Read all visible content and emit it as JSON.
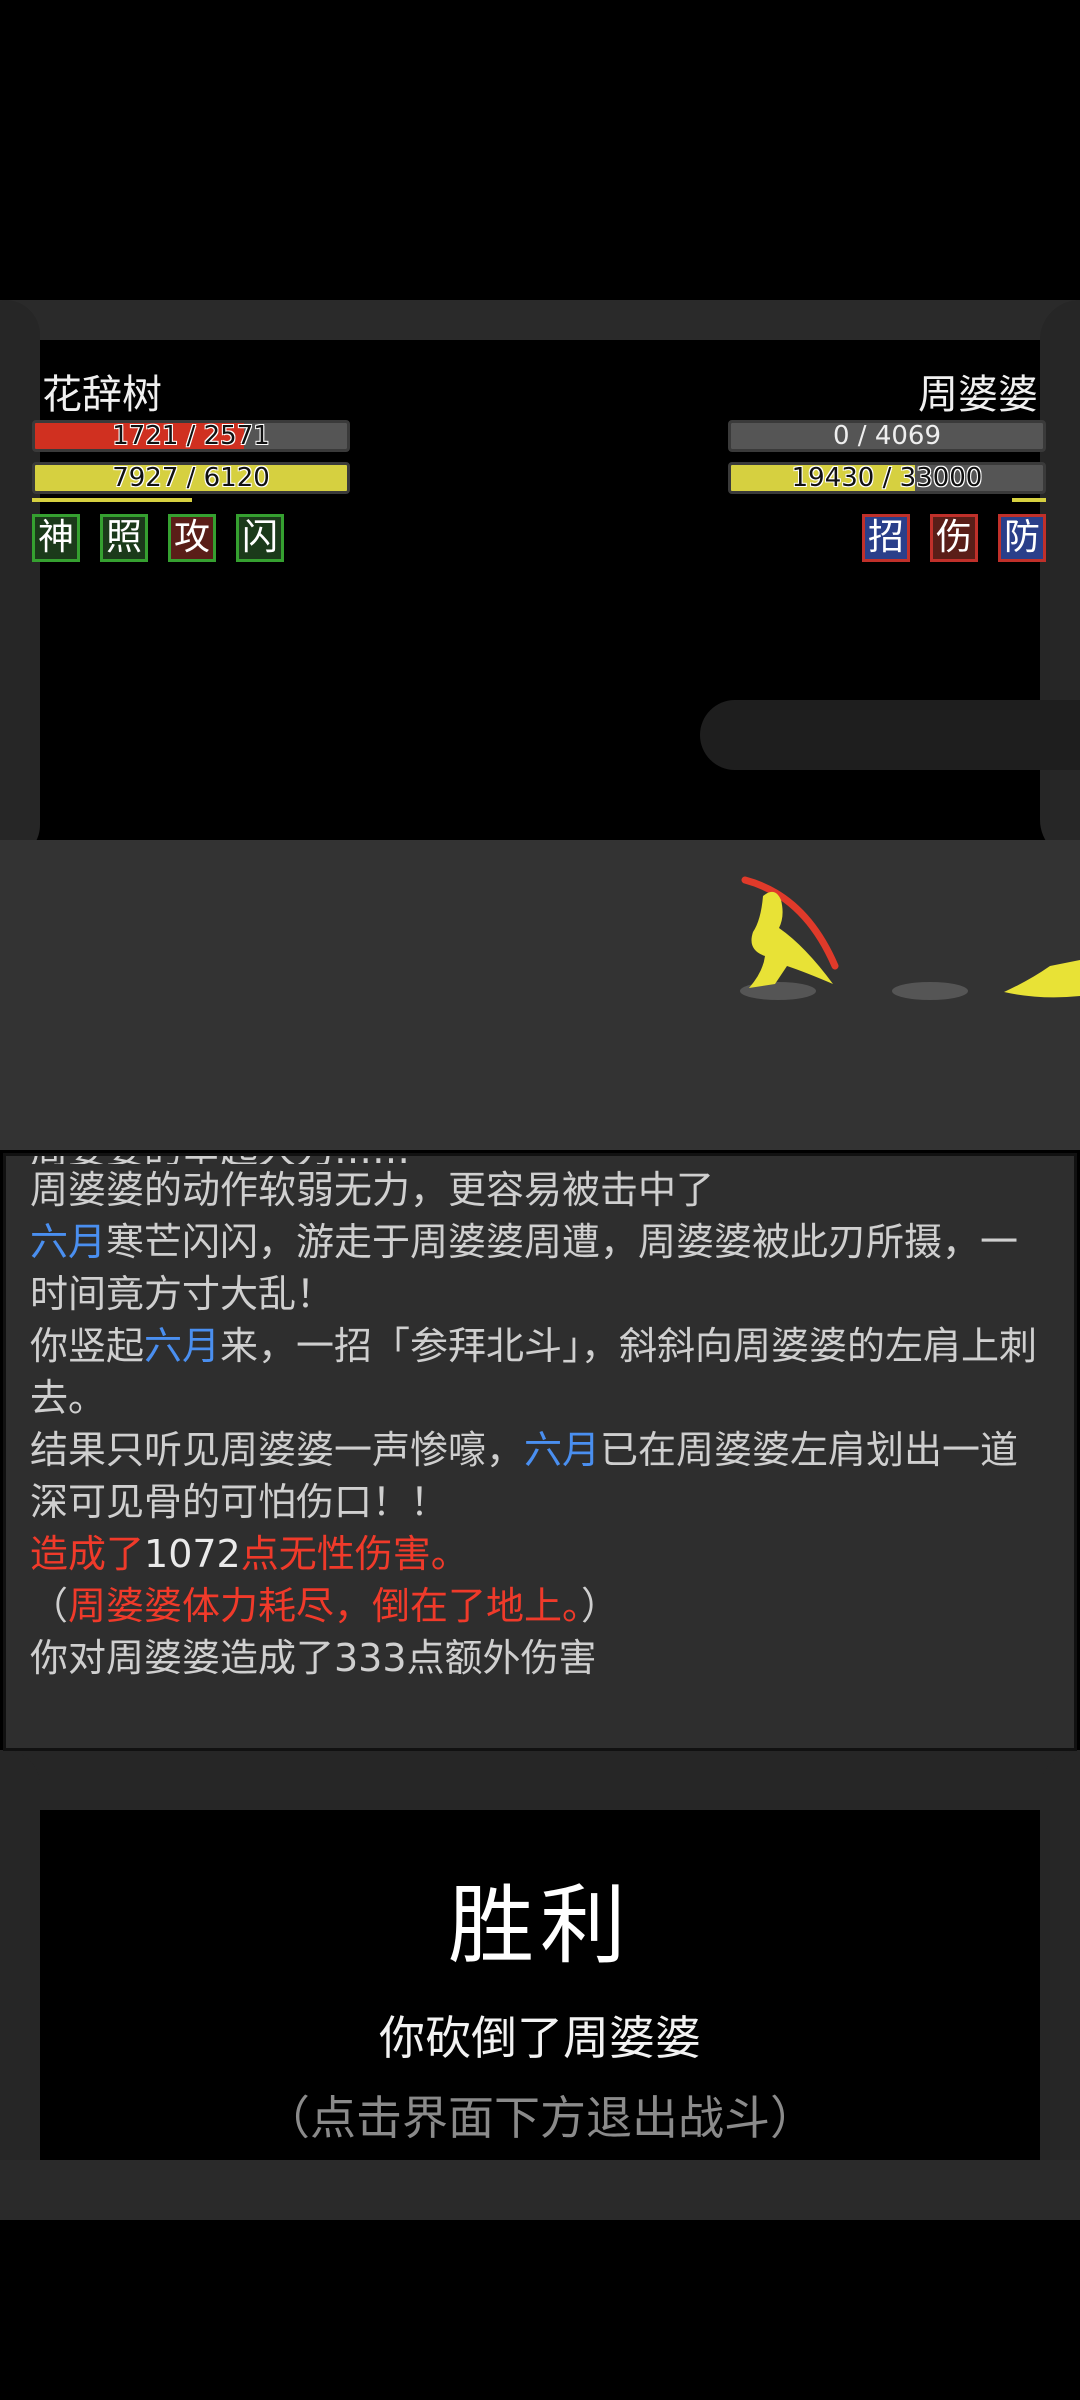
{
  "player": {
    "name": "花辞树",
    "hp_text": "1721 / 2571",
    "hp_fraction": 0.669,
    "mp_text": "7927 / 6120",
    "mp_fraction": 1.0,
    "badges": [
      "神",
      "照",
      "攻",
      "闪"
    ]
  },
  "enemy": {
    "name": "周婆婆",
    "hp_text": "0 / 4069",
    "hp_fraction": 0.0,
    "mp_text": "19430 / 33000",
    "mp_fraction": 0.589,
    "badges": [
      "招",
      "伤",
      "防"
    ]
  },
  "log": {
    "partial_line": "周婆婆的举起大刀……",
    "line1": "周婆婆的动作软弱无力，更容易被击中了",
    "line2_weapon": "六月",
    "line2_text": "寒芒闪闪，游走于周婆婆周遭，周婆婆被此刃所摄，一时间竟方寸大乱！",
    "line3_pre": "你竖起",
    "line3_weapon": "六月",
    "line3_text": "来，一招「参拜北斗」，斜斜向周婆婆的左肩上刺去。",
    "line4_pre": "结果只听见周婆婆一声惨嚎，",
    "line4_weapon": "六月",
    "line4_text": "已在周婆婆左肩划出一道深可见骨的可怕伤口！！",
    "line5_pre": "造成了",
    "line5_num": "1072",
    "line5_post": "点无性伤害。",
    "line6_open": "（",
    "line6_text": "周婆婆体力耗尽，倒在了地上。",
    "line6_close": "）",
    "line7": "你对周婆婆造成了333点额外伤害"
  },
  "result": {
    "title": "胜利",
    "subtitle": "你砍倒了周婆婆",
    "hint": "（点击界面下方退出战斗）"
  },
  "colors": {
    "hp_bar": "#d03020",
    "mp_bar": "#d6d040",
    "weapon_text": "#4a8ff0",
    "damage_text": "#f03a2a",
    "badge_green": "#35a030",
    "badge_red": "#c0302a",
    "badge_blue": "#2a3f8a"
  }
}
